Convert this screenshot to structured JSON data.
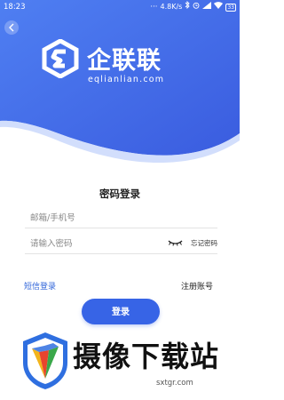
{
  "status_bar": {
    "time": "18:23",
    "dots": "···",
    "speed": "4.8K/s",
    "battery": "33"
  },
  "colors": {
    "brand_blue": "#3764e6",
    "link_blue": "#2f64d9",
    "hero_gradient": [
      "#4a7af0",
      "#3c5fe0"
    ]
  },
  "brand": {
    "name": "企联联",
    "domain": "eqlianlian.com"
  },
  "login_form": {
    "title": "密码登录",
    "account_placeholder": "邮箱/手机号",
    "password_placeholder": "请输入密码",
    "forgot_password": "忘记密码",
    "sms_login": "短信登录",
    "register": "注册账号",
    "submit": "登录"
  },
  "watermark": {
    "title": "摄像下载站",
    "url": "sxtgr.com"
  },
  "icons": [
    "back-icon",
    "brand-logo-icon",
    "eye-closed-icon",
    "watermark-logo-icon"
  ]
}
